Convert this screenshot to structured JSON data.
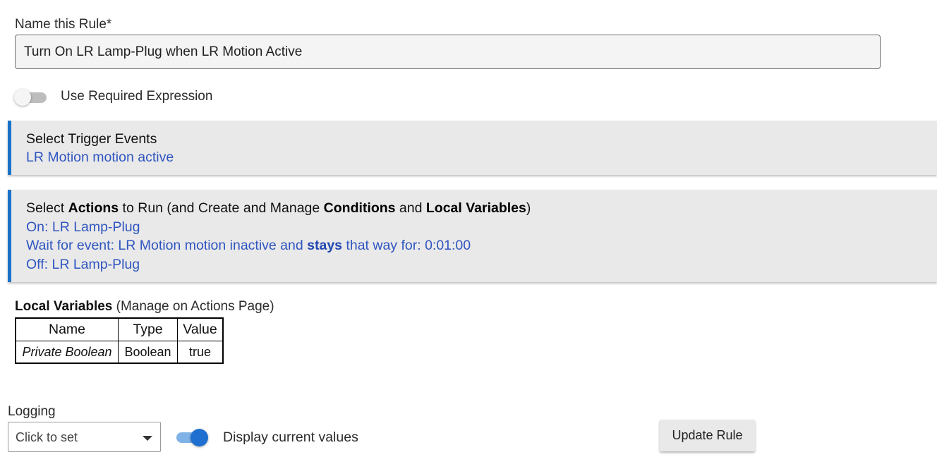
{
  "rule_name": {
    "label": "Name this Rule*",
    "value": "Turn On LR Lamp-Plug when LR Motion Active"
  },
  "required_expression": {
    "label": "Use Required Expression",
    "enabled": false
  },
  "trigger_section": {
    "title": "Select Trigger Events",
    "items": [
      "LR Motion motion active"
    ]
  },
  "actions_section": {
    "title_parts": {
      "t1": "Select ",
      "t2": "Actions",
      "t3": " to Run (and Create and Manage ",
      "t4": "Conditions",
      "t5": " and ",
      "t6": "Local Variables",
      "t7": ")"
    },
    "items": {
      "on": "On: LR Lamp-Plug",
      "wait_prefix": "Wait for event: LR Motion motion inactive and ",
      "wait_bold": "stays",
      "wait_suffix": " that way for: 0:01:00",
      "off": "Off: LR Lamp-Plug"
    }
  },
  "local_variables": {
    "label_bold": "Local Variables",
    "label_rest": " (Manage on Actions Page)",
    "columns": [
      "Name",
      "Type",
      "Value"
    ],
    "rows": [
      {
        "name": "Private Boolean",
        "type": "Boolean",
        "value": "true"
      }
    ]
  },
  "logging": {
    "label": "Logging",
    "selected": "Click to set"
  },
  "display_current_values": {
    "label": "Display current values",
    "enabled": true
  },
  "update_button": {
    "label": "Update Rule"
  },
  "colors": {
    "accent": "#1a73c8",
    "link": "#2f55c0",
    "section_bg": "#e9e9e9"
  }
}
